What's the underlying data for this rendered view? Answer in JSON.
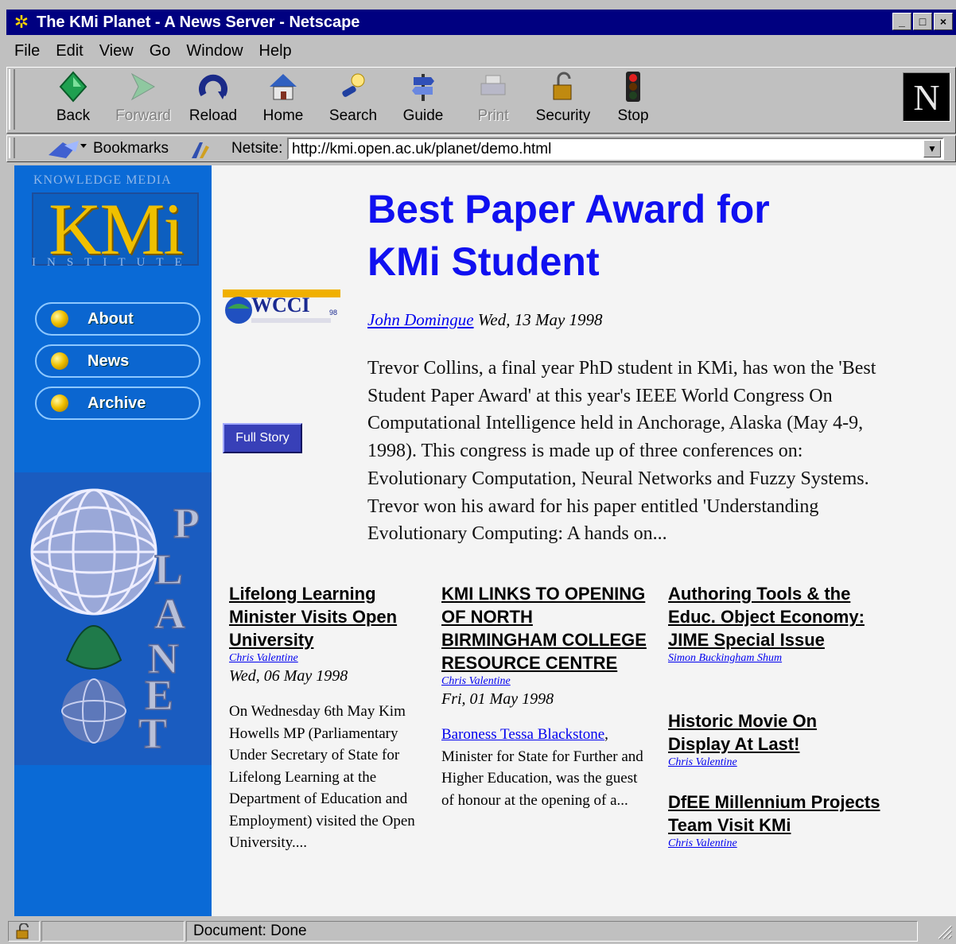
{
  "window": {
    "title": "The KMi Planet - A News Server - Netscape",
    "min": "_",
    "max": "□",
    "close": "×"
  },
  "menu": [
    "File",
    "Edit",
    "View",
    "Go",
    "Window",
    "Help"
  ],
  "toolbar": {
    "back": "Back",
    "forward": "Forward",
    "reload": "Reload",
    "home": "Home",
    "search": "Search",
    "guide": "Guide",
    "print": "Print",
    "security": "Security",
    "stop": "Stop",
    "n_logo": "N"
  },
  "location": {
    "bookmarks": "Bookmarks",
    "netsite_label": "Netsite:",
    "url": "http://kmi.open.ac.uk/planet/demo.html"
  },
  "sidebar": {
    "logo_top": "KNOWLEDGE MEDIA",
    "logo": "KMi",
    "logo_bottom": "INSTITUTE",
    "nav": [
      "About",
      "News",
      "Archive"
    ],
    "planet_letters": [
      "P",
      "L",
      "A",
      "N",
      "E",
      "T"
    ]
  },
  "lead": {
    "headline_1": "Best Paper Award for",
    "headline_2": "KMi Student",
    "wcci": "WCCI",
    "wcci_sup": "98",
    "author": "John Domingue",
    "date": "Wed, 13 May 1998",
    "full_story": "Full Story",
    "body": "Trevor Collins, a final year PhD student in KMi, has won the 'Best Student Paper Award' at this year's IEEE World Congress On Computational Intelligence held in Anchorage, Alaska (May 4-9, 1998). This congress is made up of three conferences on: Evolutionary Computation, Neural Networks and Fuzzy Systems. Trevor won his award for his paper entitled 'Understanding Evolutionary Computing: A hands on..."
  },
  "stories": [
    {
      "title": "Lifelong Learning Minister Visits Open University",
      "author": "Chris Valentine",
      "date": "Wed, 06 May 1998",
      "body": "On Wednesday 6th May Kim Howells MP (Parliamentary Under Secretary of State for Lifelong Learning at the Department of Education and Employment) visited the Open University...."
    },
    {
      "title": "KMI LINKS TO OPENING OF NORTH BIRMINGHAM COLLEGE RESOURCE CENTRE",
      "author": "Chris Valentine",
      "date": "Fri, 01 May 1998",
      "body_link": "Baroness Tessa Blackstone",
      "body_rest": ", Minister for State for Further and Higher Education, was the guest of honour at the opening of a..."
    },
    {
      "title": "Authoring Tools & the Educ. Object Economy: JIME Special Issue",
      "author": "Simon Buckingham Shum"
    },
    {
      "title": "Historic Movie On Display At Last!",
      "author": "Chris Valentine"
    },
    {
      "title": "DfEE Millennium Projects Team Visit KMi",
      "author": "Chris Valentine"
    }
  ],
  "status": {
    "text": "Document: Done"
  }
}
